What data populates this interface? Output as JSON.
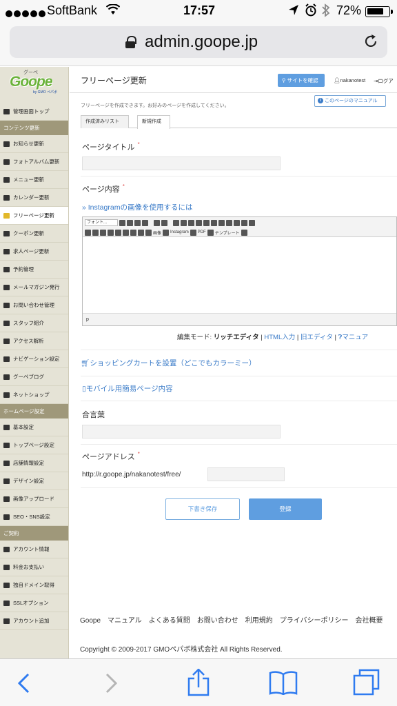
{
  "status": {
    "carrier": "SoftBank",
    "time": "17:57",
    "battery": "72%"
  },
  "browser": {
    "url": "admin.goope.jp"
  },
  "sidebar": {
    "logo_ruby": "グーペ",
    "logo": "Goope",
    "logo_by": "by GMO ペパボ",
    "top_item": "管理画面トップ",
    "sections": [
      {
        "head": "コンテンツ更新",
        "items": [
          "お知らせ更新",
          "フォトアルバム更新",
          "メニュー更新",
          "カレンダー更新",
          "フリーページ更新",
          "クーポン更新",
          "求人ページ更新",
          "予約管理",
          "メールマガジン発行",
          "お問い合わせ管理",
          "スタッフ紹介",
          "アクセス解析",
          "ナビゲーション設定",
          "グーペブログ",
          "ネットショップ"
        ]
      },
      {
        "head": "ホームページ設定",
        "items": [
          "基本設定",
          "トップページ設定",
          "店舗情報設定",
          "デザイン設定",
          "画像アップロード",
          "SEO・SNS設定"
        ]
      },
      {
        "head": "ご契約",
        "items": [
          "アカウント情報",
          "料金お支払い",
          "独自ドメイン取得",
          "SSLオプション",
          "アカウント追加"
        ]
      }
    ]
  },
  "header": {
    "title": "フリーページ更新",
    "site_button": "サイトを確認",
    "user": "nakanotest",
    "logout": "ログア"
  },
  "page": {
    "description": "フリーページを作成できます。お好みのページを作成してください。",
    "manual": "このページのマニュアル",
    "tabs": [
      "作成済みリスト",
      "新規作成"
    ],
    "title_label": "ページタイトル",
    "required": "*",
    "content_label": "ページ内容",
    "instagram_link": "» Instagramの画像を使用するには",
    "editor": {
      "font_select": "フォント...",
      "image": "画像",
      "instagram": "Instagram",
      "pdf": "PDF",
      "template": "テンプレート",
      "path": "p"
    },
    "mode_prefix": "編集モード:",
    "mode_rich": "リッチエディタ",
    "mode_sep": "|",
    "mode_html": "HTML入力",
    "mode_old": "旧エディタ",
    "mode_manual": "マニュア",
    "cart_link": "ショッピングカートを設置（どこでもカラーミー）",
    "mobile_link": "モバイル用簡易ページ内容",
    "password_label": "合言葉",
    "address_label": "ページアドレス",
    "address_prefix": "http://r.goope.jp/nakanotest/free/",
    "draft_button": "下書き保存",
    "register_button": "登録"
  },
  "footer": {
    "links": "Goope　マニュアル　よくある質問　お問い合わせ　利用規約　プライバシーポリシー　会社概要",
    "copyright": "Copyright © 2009-2017 GMOペパボ株式会社 All Rights Reserved."
  }
}
